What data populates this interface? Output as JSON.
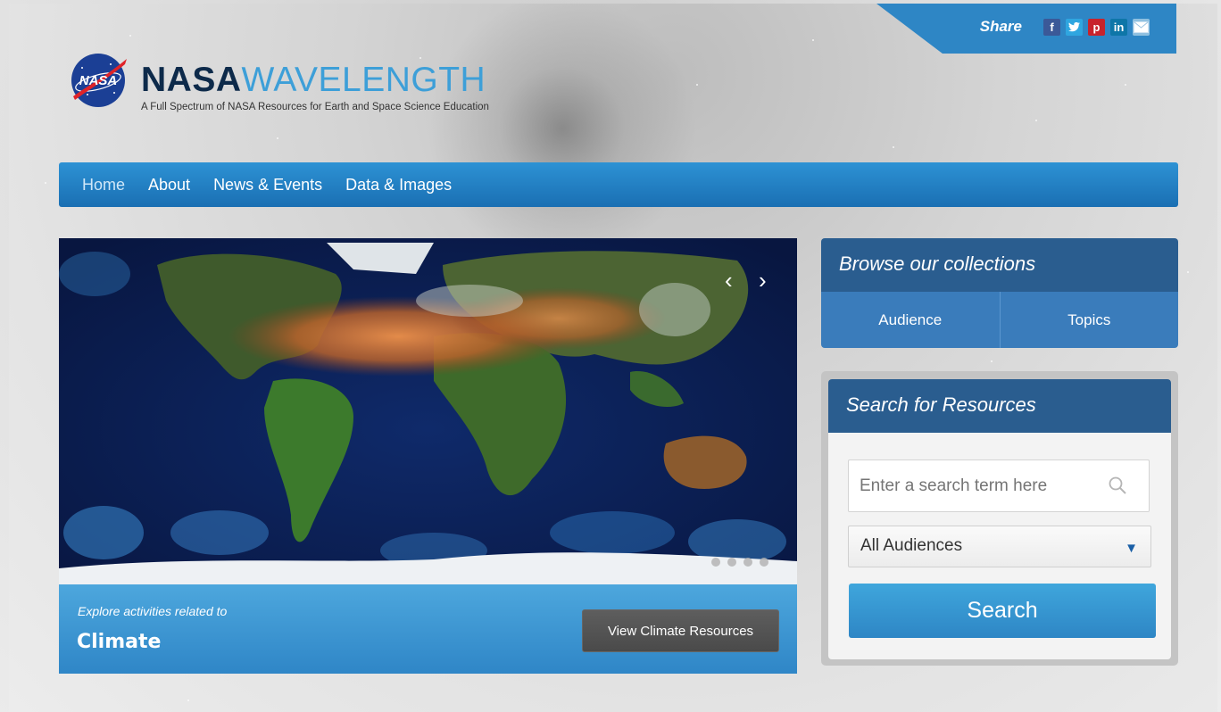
{
  "share": {
    "label": "Share",
    "icons": [
      "facebook-icon",
      "twitter-icon",
      "pinterest-icon",
      "linkedin-icon",
      "email-icon"
    ],
    "facebook_glyph": "f",
    "pinterest_glyph": "p",
    "linkedin_glyph": "in"
  },
  "logo": {
    "meatball_text": "NASA",
    "title_bold": "NASA",
    "title_light": "WAVELENGTH",
    "tagline": "A Full Spectrum of NASA Resources for Earth and Space Science Education"
  },
  "nav": {
    "items": [
      {
        "label": "Home",
        "active": true
      },
      {
        "label": "About"
      },
      {
        "label": "News & Events"
      },
      {
        "label": "Data & Images"
      }
    ]
  },
  "hero": {
    "subtitle": "Explore activities related to",
    "title": "Climate",
    "button": "View Climate Resources",
    "prev_arrow": "‹",
    "next_arrow": "›",
    "slide_count": 4
  },
  "browse": {
    "title": "Browse our collections",
    "links": [
      "Audience",
      "Topics"
    ]
  },
  "search": {
    "title": "Search for Resources",
    "placeholder": "Enter a search term here",
    "audience_selected": "All Audiences",
    "caret": "▼",
    "button": "Search"
  },
  "colors": {
    "nav_blue": "#2e86c5",
    "header_dark_blue": "#2a5d8f",
    "brand_navy": "#0d2a4a",
    "brand_light_blue": "#3d9fd8"
  }
}
